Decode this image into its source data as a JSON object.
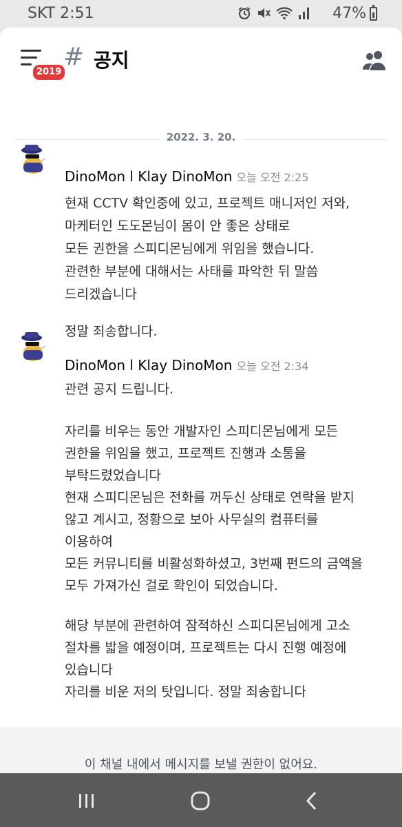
{
  "status_bar": {
    "carrier_time": "SKT 2:51",
    "battery_percent": "47%",
    "icons": [
      "alarm-icon",
      "mute-icon",
      "wifi-icon",
      "signal-icon",
      "battery-icon"
    ]
  },
  "header": {
    "menu_icon": "hamburger-menu-icon",
    "badge": "2019",
    "hash": "#",
    "channel_name": "공지",
    "members_icon": "members-icon"
  },
  "date_divider": "2022. 3. 20.",
  "messages": [
    {
      "author": "DinoMon l Klay DinoMon",
      "time": "오늘 오전 2:25",
      "lines": [
        "현재 CCTV 확인중에 있고, 프로젝트 매니저인 저와,",
        "마케터인 도도몬님이 몸이 안 좋은 상태로",
        "모든 권한을 스피디몬님에게 위임을 했습니다.",
        "관련한 부분에 대해서는 사태를 파악한 뒤 말씀",
        "드리겠습니다",
        "",
        "정말 죄송합니다."
      ]
    },
    {
      "author": "DinoMon l Klay DinoMon",
      "time": "오늘 오전 2:34",
      "lines": [
        "관련 공지 드립니다.",
        "",
        "자리를 비우는 동안 개발자인 스피디몬님에게 모든",
        "권한을 위임을 했고, 프로젝트 진행과 소통을",
        "부탁드렸었습니다",
        "현재 스피디몬님은 전화를 꺼두신 상태로 연락을 받지",
        "않고 계시고, 정황으로 보아 사무실의 컴퓨터를",
        "이용하여",
        "모든 커뮤니티를 비활성화하셨고, 3번째 펀드의 금액을",
        "모두 가져가신 걸로 확인이 되었습니다.",
        "",
        "해당 부분에 관련하여 잠적하신 스피디몬님에게 고소",
        "절차를 밟을 예정이며, 프로젝트는 다시 진행 예정에",
        "있습니다",
        "자리를 비운 저의 탓입니다. 정말 죄송합니다"
      ]
    }
  ],
  "composer_notice": "이 채널 내에서 메시지를 보낼 권한이 없어요.",
  "navbar": {
    "icons": [
      "recent-apps-icon",
      "home-icon",
      "back-icon"
    ]
  },
  "colors": {
    "badge": "#e03c3c",
    "text": "#2e3338",
    "muted": "#747f8d",
    "navbar": "#5a5a5a"
  }
}
